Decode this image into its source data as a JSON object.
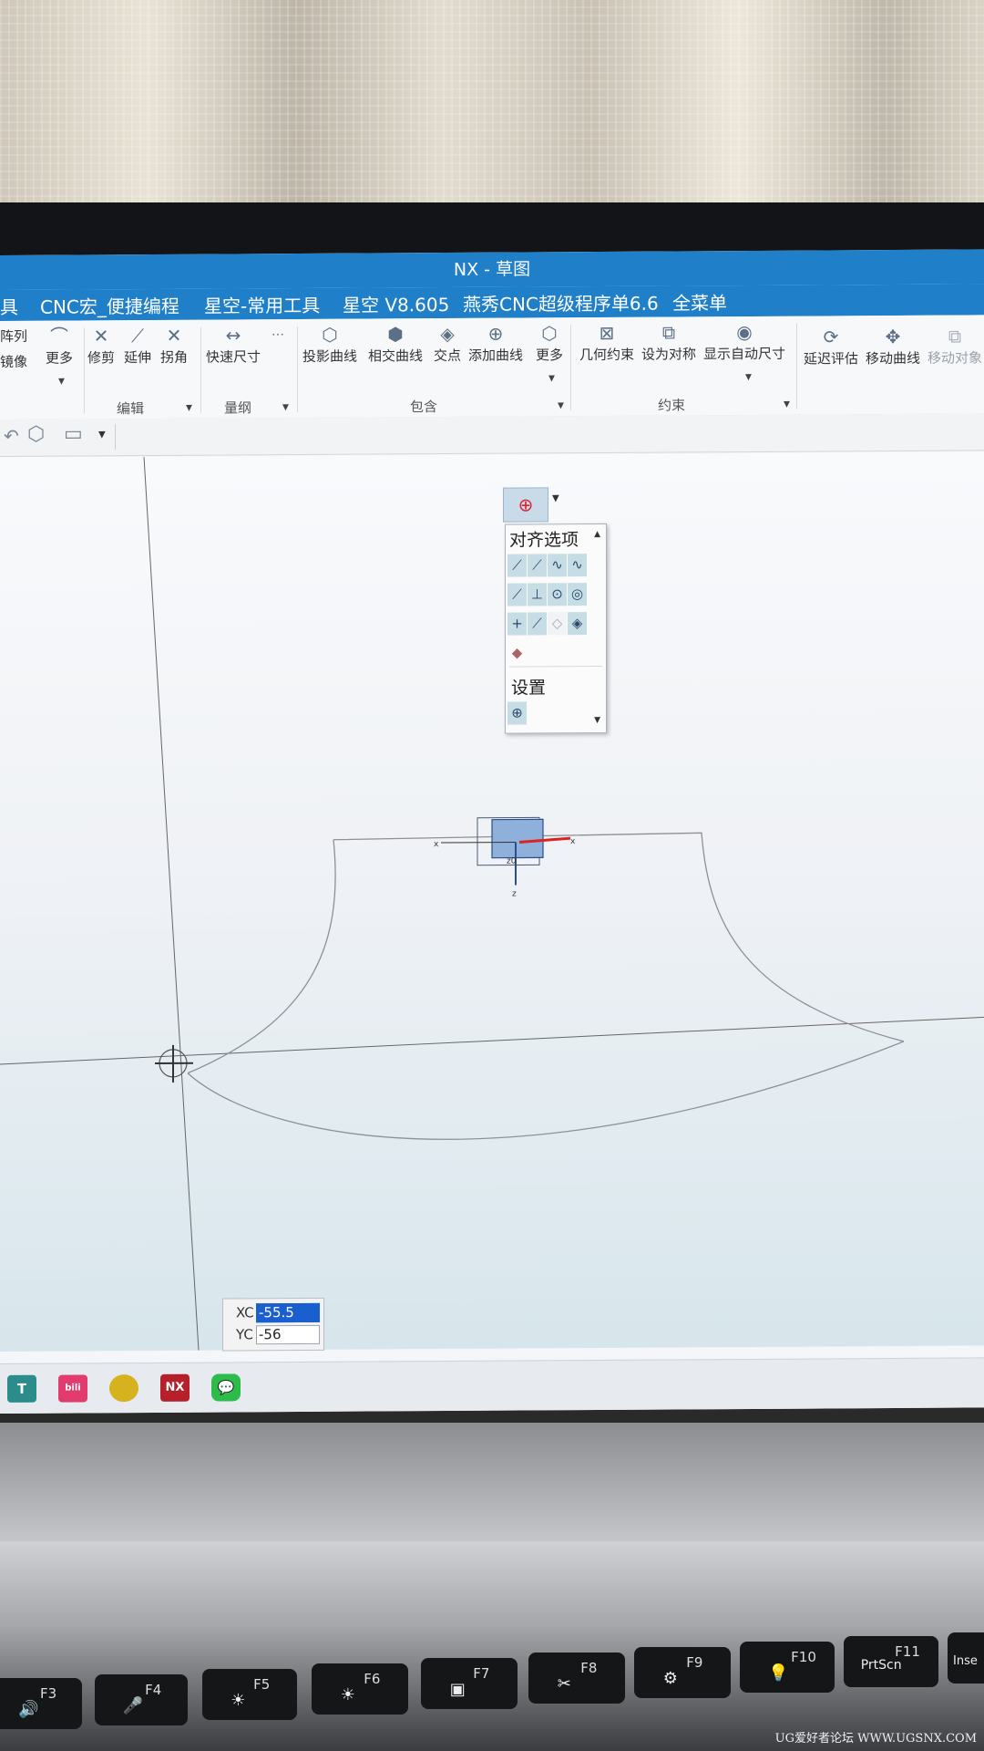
{
  "window": {
    "title": "NX - 草图"
  },
  "menubar": {
    "items": [
      "具",
      "CNC宏_便捷编程",
      "星空-常用工具",
      "星空 V8.605",
      "燕秀CNC超级程序单6.6",
      "全菜单"
    ]
  },
  "ribbon": {
    "tools": {
      "array": "阵列",
      "mirror": "镜像",
      "more1": "更多",
      "trim": "修剪",
      "extend": "延伸",
      "fillet": "拐角",
      "rapid_dim": "快速尺寸",
      "project_curve": "投影曲线",
      "intersect_curve": "相交曲线",
      "intersection_point": "交点",
      "add_curve": "添加曲线",
      "more2": "更多",
      "geo_constraint": "几何约束",
      "set_symmetric": "设为对称",
      "show_auto_dim": "显示自动尺寸",
      "delay_eval": "延迟评估",
      "move_curve": "移动曲线",
      "move_object": "移动对象"
    },
    "groups": {
      "edit": "编辑",
      "dimension": "量纲",
      "include": "包含",
      "constraint": "约束"
    }
  },
  "snap_menu": {
    "header": "对齐选项",
    "settings": "设置"
  },
  "coord_input": {
    "xc_label": "XC",
    "xc_value": "-55.5",
    "yc_label": "YC",
    "yc_value": "-56"
  },
  "axes": {
    "x": "x",
    "z": "z",
    "zc": "z0"
  },
  "taskbar": {
    "nx_label": "NX",
    "t_label": "T",
    "bili_label": "bili"
  },
  "keyboard": {
    "keys": [
      {
        "fn": "F3",
        "sym": "🔊"
      },
      {
        "fn": "F4",
        "sym": "🎤"
      },
      {
        "fn": "F5",
        "sym": "☀"
      },
      {
        "fn": "F6",
        "sym": "☀"
      },
      {
        "fn": "F7",
        "sym": "▣"
      },
      {
        "fn": "F8",
        "sym": "✂"
      },
      {
        "fn": "F9",
        "sym": "⚙"
      },
      {
        "fn": "F10",
        "sym": "💡"
      },
      {
        "fn": "F11",
        "sym": "PrtScn"
      },
      {
        "fn": "",
        "sym": "Inse"
      }
    ]
  },
  "watermark": "UG爱好者论坛 WWW.UGSNX.COM"
}
